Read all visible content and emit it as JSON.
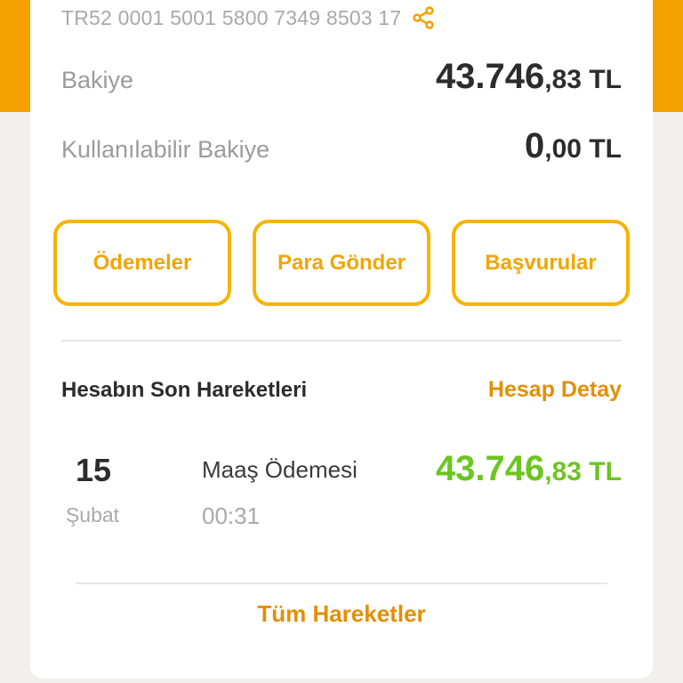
{
  "colors": {
    "accent": "#f5a100",
    "button_border": "#f5b400",
    "link": "#e58e00",
    "positive": "#6cc521",
    "text_dark": "#2c2c2c",
    "text_muted": "#a9a9a9"
  },
  "account": {
    "iban": "TR52 0001 5001 5800 7349 8503 17",
    "share_icon": "share-icon"
  },
  "balance": {
    "label": "Bakiye",
    "integer": "43.746",
    "decimal": ",83",
    "currency": " TL"
  },
  "available_balance": {
    "label": "Kullanılabilir Bakiye",
    "integer": "0",
    "decimal": ",00",
    "currency": " TL"
  },
  "actions": {
    "payments": "Ödemeler",
    "send_money": "Para Gönder",
    "applications": "Başvurular"
  },
  "transactions_section": {
    "title": "Hesabın Son Hareketleri",
    "detail_link": "Hesap Detay",
    "items": [
      {
        "day": "15",
        "month": "Şubat",
        "description": "Maaş Ödemesi",
        "time": "00:31",
        "amount_integer": "43.746",
        "amount_decimal": ",83",
        "amount_currency": " TL"
      }
    ],
    "all_link": "Tüm Hareketler"
  }
}
